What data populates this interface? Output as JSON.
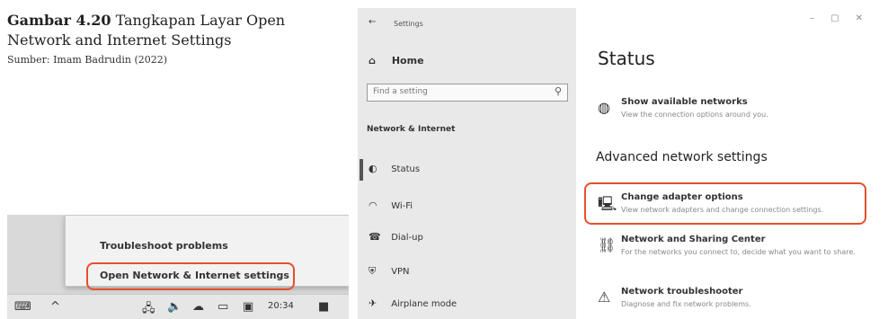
{
  "caption": {
    "figure_label": "Gambar 4.20",
    "figure_title": "Tangkapan Layar Open Network and Internet Settings",
    "source": "Sumber: Imam Badrudin (2022)"
  },
  "taskbar_screenshot": {
    "context_menu": {
      "items": [
        "Troubleshoot problems",
        "Open Network & Internet settings"
      ],
      "highlighted_item": "Open Network & Internet settings"
    },
    "time": "20:34"
  },
  "settings_screenshot": {
    "window_title": "Settings",
    "home_label": "Home",
    "search_placeholder": "Find a setting",
    "section_label": "Network & Internet",
    "nav_items": [
      "Status",
      "Wi-Fi",
      "Dial-up",
      "VPN",
      "Airplane mode"
    ],
    "active_nav": "Status",
    "page_title": "Status",
    "show_networks": {
      "title": "Show available networks",
      "desc": "View the connection options around you."
    },
    "advanced_heading": "Advanced network settings",
    "advanced_items": [
      {
        "title": "Change adapter options",
        "desc": "View network adapters and change connection settings."
      },
      {
        "title": "Network and Sharing Center",
        "desc": "For the networks you connect to, decide what you want to share."
      },
      {
        "title": "Network troubleshooter",
        "desc": "Diagnose and fix network problems."
      }
    ],
    "highlighted_item": "Change adapter options",
    "highlight_color": "#e4502a"
  }
}
